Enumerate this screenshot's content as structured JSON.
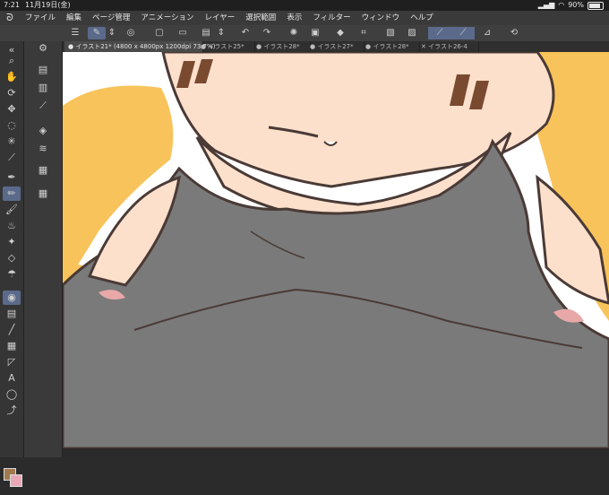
{
  "status": {
    "time": "7:21",
    "date": "11月19日(金)",
    "battery": "90%"
  },
  "menu": [
    "ファイル",
    "編集",
    "ページ管理",
    "アニメーション",
    "レイヤー",
    "選択範囲",
    "表示",
    "フィルター",
    "ウィンドウ",
    "ヘルプ"
  ],
  "tabs": [
    {
      "label": "● イラスト21* (4800 x 4800px 1200dpi 73.7%)"
    },
    {
      "label": "● イラスト25*"
    },
    {
      "label": "● イラスト28*"
    },
    {
      "label": "● イラスト27*"
    },
    {
      "label": "● イラスト28*"
    },
    {
      "label": "✕ イラスト26-4"
    }
  ],
  "colors": {
    "main": "#a07a4e",
    "sub": "#e8a8b6",
    "accent": "#5b6a8a",
    "shirt": "#7a7a7a",
    "skin": "#fde0cb",
    "hair": "#f8c35a",
    "outline": "#4a3a36"
  },
  "icons": {
    "app": "clip-studio-logo-icon",
    "battery": "battery-icon"
  }
}
